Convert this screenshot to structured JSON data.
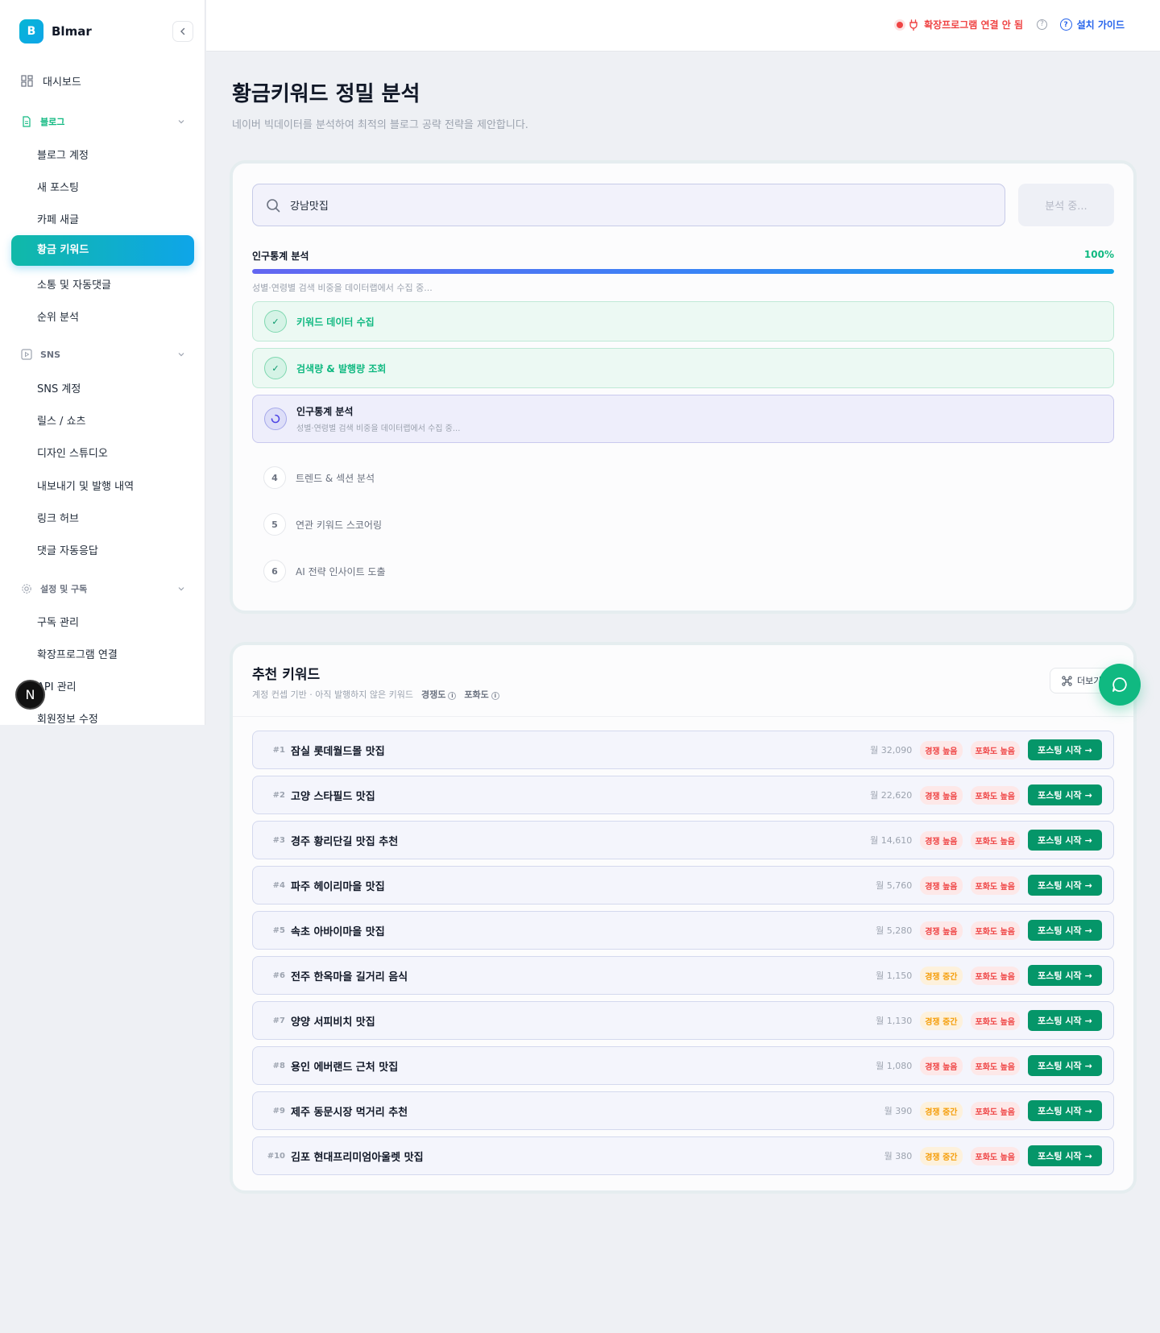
{
  "brand": {
    "logo_letter": "B",
    "name": "Blmar"
  },
  "sidebar": {
    "dashboard": "대시보드",
    "blog_section": "블로그",
    "blog_items": [
      "블로그 계정",
      "새 포스팅",
      "카페 새글"
    ],
    "active_item": "황금 키워드",
    "blog_items_after": [
      "소통 및 자동댓글",
      "순위 분석"
    ],
    "sns_section": "SNS",
    "sns_items": [
      "SNS 계정",
      "릴스 / 쇼츠",
      "디자인 스튜디오",
      "내보내기 및 발행 내역",
      "링크 허브",
      "댓글 자동응답"
    ],
    "settings_section": "설정 및 구독",
    "settings_items": [
      "구독 관리",
      "확장프로그램 연결",
      "API 관리",
      "회원정보 수정"
    ],
    "avatar_letter": "N"
  },
  "topbar": {
    "extension_status": "확장프로그램 연결 안 됨",
    "install_guide": "설치 가이드"
  },
  "header": {
    "title": "황금키워드 정밀 분석",
    "subtitle": "네이버 빅데이터를 분석하여 최적의 블로그 공략 전략을 제안합니다."
  },
  "analysis": {
    "search_value": "강남맛집",
    "analyze_button": "분석 중...",
    "progress_label": "인구통계 분석",
    "progress_percent_text": "100%",
    "progress_percent": 100,
    "progress_desc": "성별·연령별 검색 비중을 데이터랩에서 수집 중...",
    "steps": [
      {
        "status": "done",
        "label": "키워드 데이터 수집"
      },
      {
        "status": "done",
        "label": "검색량 & 발행량 조회"
      },
      {
        "status": "active",
        "label": "인구통계 분석",
        "sub": "성별·연령별 검색 비중을 데이터랩에서 수집 중..."
      },
      {
        "status": "pending",
        "num": "4",
        "label": "트렌드 & 섹션 분석"
      },
      {
        "status": "pending",
        "num": "5",
        "label": "연관 키워드 스코어링"
      },
      {
        "status": "pending",
        "num": "6",
        "label": "AI 전략 인사이트 도출"
      }
    ]
  },
  "recommended": {
    "title": "추천 키워드",
    "subtitle": "계정 컨셉 기반 · 아직 발행하지 않은 키워드",
    "competition_label": "경쟁도",
    "saturation_label": "포화도",
    "more_button": "더보기",
    "post_button": "포스팅 시작",
    "keywords": [
      {
        "rank": "#1",
        "name": "잠실 롯데월드몰 맛집",
        "volume": "월 32,090",
        "competition": "경쟁 높음",
        "comp_level": "high",
        "saturation": "포화도 높음"
      },
      {
        "rank": "#2",
        "name": "고양 스타필드 맛집",
        "volume": "월 22,620",
        "competition": "경쟁 높음",
        "comp_level": "high",
        "saturation": "포화도 높음"
      },
      {
        "rank": "#3",
        "name": "경주 황리단길 맛집 추천",
        "volume": "월 14,610",
        "competition": "경쟁 높음",
        "comp_level": "high",
        "saturation": "포화도 높음"
      },
      {
        "rank": "#4",
        "name": "파주 헤이리마을 맛집",
        "volume": "월 5,760",
        "competition": "경쟁 높음",
        "comp_level": "high",
        "saturation": "포화도 높음"
      },
      {
        "rank": "#5",
        "name": "속초 아바이마을 맛집",
        "volume": "월 5,280",
        "competition": "경쟁 높음",
        "comp_level": "high",
        "saturation": "포화도 높음"
      },
      {
        "rank": "#6",
        "name": "전주 한옥마을 길거리 음식",
        "volume": "월 1,150",
        "competition": "경쟁 중간",
        "comp_level": "mid",
        "saturation": "포화도 높음"
      },
      {
        "rank": "#7",
        "name": "양양 서피비치 맛집",
        "volume": "월 1,130",
        "competition": "경쟁 중간",
        "comp_level": "mid",
        "saturation": "포화도 높음"
      },
      {
        "rank": "#8",
        "name": "용인 에버랜드 근처 맛집",
        "volume": "월 1,080",
        "competition": "경쟁 높음",
        "comp_level": "high",
        "saturation": "포화도 높음"
      },
      {
        "rank": "#9",
        "name": "제주 동문시장 먹거리 추천",
        "volume": "월 390",
        "competition": "경쟁 중간",
        "comp_level": "mid",
        "saturation": "포화도 높음"
      },
      {
        "rank": "#10",
        "name": "김포 현대프리미엄아울렛 맛집",
        "volume": "월 380",
        "competition": "경쟁 중간",
        "comp_level": "mid",
        "saturation": "포화도 높음"
      }
    ]
  },
  "colors": {
    "accent": "#10b981",
    "primary_btn": "#059669",
    "danger": "#ef4444",
    "link": "#2563eb"
  }
}
